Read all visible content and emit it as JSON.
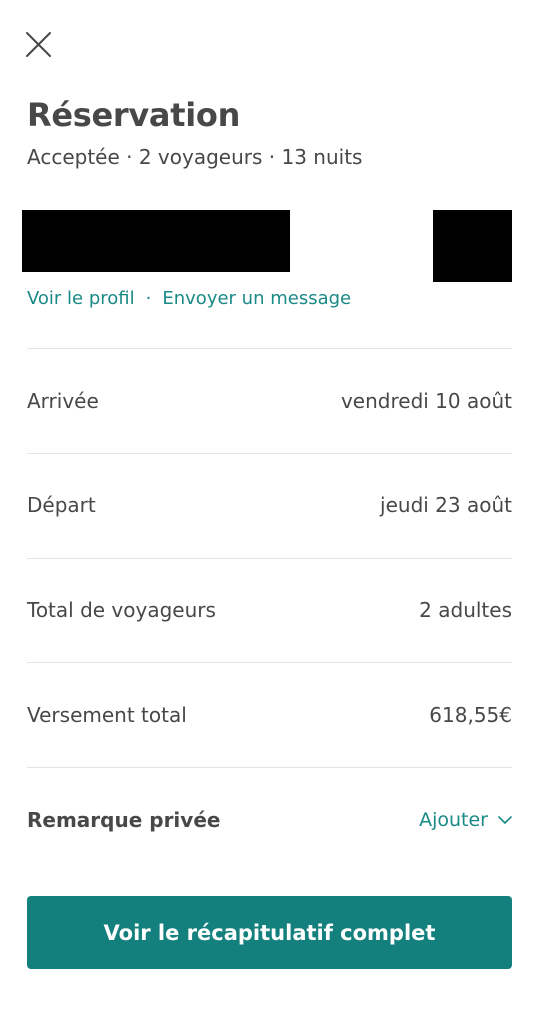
{
  "header": {
    "title": "Réservation",
    "subtitle": "Acceptée · 2 voyageurs · 13 nuits"
  },
  "guest": {
    "profile_link": "Voir le profil",
    "separator": "·",
    "message_link": "Envoyer un message"
  },
  "details": [
    {
      "label": "Arrivée",
      "value": "vendredi 10 août"
    },
    {
      "label": "Départ",
      "value": "jeudi 23 août"
    },
    {
      "label": "Total de voyageurs",
      "value": "2 adultes"
    },
    {
      "label": "Versement total",
      "value": "618,55€"
    }
  ],
  "private_note": {
    "label": "Remarque privée",
    "action": "Ajouter"
  },
  "cta": {
    "label": "Voir le récapitulatif complet"
  },
  "colors": {
    "accent": "#1a8a86",
    "button": "#14807e",
    "text": "#484848",
    "divider": "#e4e4e4"
  },
  "icons": {
    "close": "close-icon",
    "chevron": "chevron-down-icon"
  }
}
